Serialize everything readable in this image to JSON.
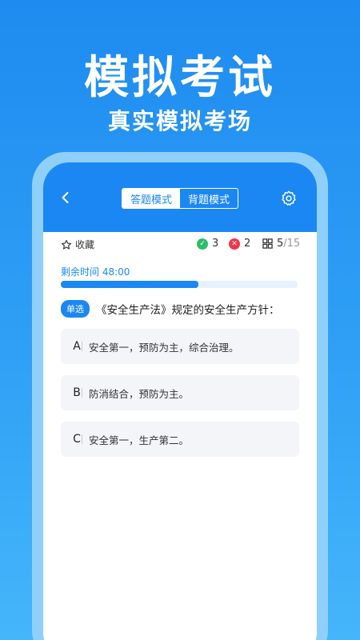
{
  "hero": {
    "title": "模拟考试",
    "subtitle": "真实模拟考场"
  },
  "header": {
    "tabs": [
      {
        "label": "答题模式",
        "active": true
      },
      {
        "label": "背题模式",
        "active": false
      }
    ]
  },
  "stats": {
    "favorite_label": "收藏",
    "correct": "3",
    "wrong": "2",
    "current": "5",
    "total": "/15"
  },
  "timer": {
    "label": "剩余时间 48:00",
    "progress": 0.58
  },
  "question": {
    "type": "单选",
    "text": "《安全生产法》规定的安全生产方针：",
    "options": [
      {
        "letter": "A",
        "text": "安全第一，预防为主，综合治理。"
      },
      {
        "letter": "B",
        "text": "防消结合，预防为主。"
      },
      {
        "letter": "C",
        "text": "安全第一，生产第二。"
      }
    ]
  },
  "colors": {
    "primary": "#1B87F2",
    "correct": "#2EBD6B",
    "wrong": "#F0354A"
  }
}
